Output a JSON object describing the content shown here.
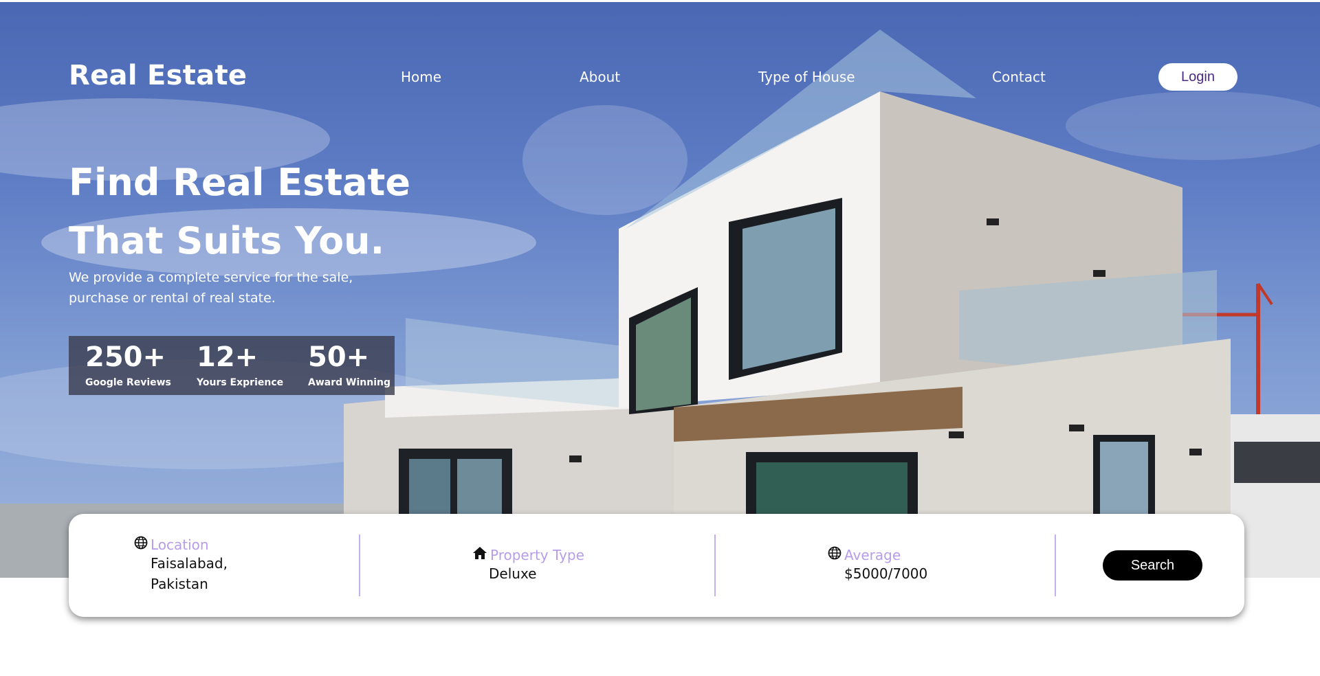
{
  "nav": {
    "brand": "Real Estate",
    "links": [
      "Home",
      "About",
      "Type of House",
      "Contact"
    ],
    "login_label": "Login"
  },
  "hero": {
    "headline_line1": "Find Real Estate",
    "headline_line2": "That Suits You.",
    "subtext_line1": "We provide a complete service for the sale,",
    "subtext_line2": "purchase or rental of real state."
  },
  "stats": [
    {
      "value": "250+",
      "label": "Google Reviews"
    },
    {
      "value": "12+",
      "label": "Yours Exprience"
    },
    {
      "value": "50+",
      "label": "Award Winning"
    }
  ],
  "search": {
    "location": {
      "label": "Location",
      "value_line1": "Faisalabad,",
      "value_line2": "Pakistan",
      "icon": "globe-icon"
    },
    "property_type": {
      "label": "Property Type",
      "value": "Deluxe",
      "icon": "home-icon"
    },
    "average": {
      "label": "Average",
      "value": "$5000/7000",
      "icon": "globe-icon"
    },
    "button_label": "Search"
  },
  "colors": {
    "accent_label": "#b79ce8",
    "divider": "#c6aff0",
    "login_text": "#4b2a86",
    "search_button": "#000000"
  }
}
